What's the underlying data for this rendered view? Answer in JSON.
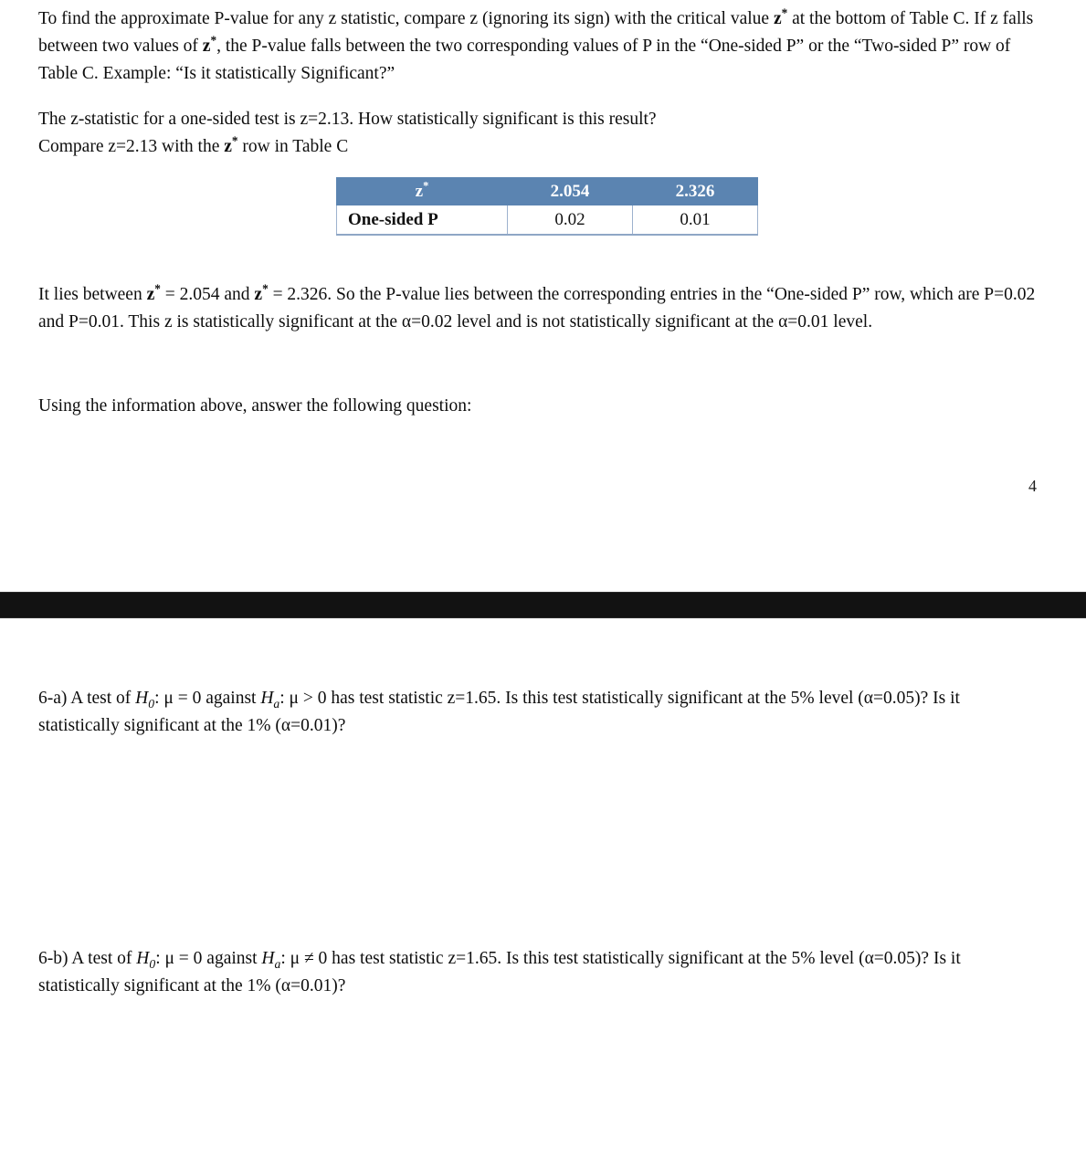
{
  "document": {
    "page_number": "4"
  },
  "intro_paragraph": {
    "seg1": "To find the approximate P-value for any z statistic, compare z (ignoring its sign) with the critical value ",
    "zstar1": "z",
    "star1": "*",
    "seg2": " at the bottom of Table C. If z falls between two values of ",
    "zstar2": "z",
    "star2": "*",
    "seg3": ", the P-value falls between the two corresponding values of P in the “One-sided P” or the “Two-sided P” row of Table C. Example: “Is it statistically Significant?”"
  },
  "example_paragraph": {
    "line1": "The z-statistic for a one-sided test is z=2.13. How statistically significant is this result?",
    "line2_seg1": "Compare z=2.13 with the ",
    "line2_zstar": "z",
    "line2_star": "*",
    "line2_seg2": " row in Table C"
  },
  "table": {
    "headers": [
      "z",
      "2.054",
      "2.326"
    ],
    "header_star": "*",
    "row_label": "One-sided P",
    "row_values": [
      "0.02",
      "0.01"
    ],
    "header_bg": "#5b84b1",
    "header_color": "#ffffff",
    "border_color": "#9db2ce"
  },
  "explanation_paragraph": {
    "seg1": "It lies between ",
    "zstar1": "z",
    "star1": "*",
    "seg2": " = 2.054 and ",
    "zstar2": "z",
    "star2": "*",
    "seg3": " = 2.326. So the P-value lies between the corresponding entries in the “One-sided P” row, which are P=0.02 and P=0.01. This z is statistically significant at the α=0.02 level and is not statistically significant at the α=0.01 level."
  },
  "prompt_line": {
    "text": "Using the information above, answer the following question:"
  },
  "questions": [
    {
      "id": "6-a",
      "label": "6-a)",
      "seg1": " A test of ",
      "h0": "H",
      "h0_sub": "0",
      "seg2": ": μ = 0 against ",
      "ha": "H",
      "ha_sub": "a",
      "seg3": ": μ > 0 has test statistic z=1.65. Is this test statistically significant at the 5% level (α=0.05)? Is it statistically significant at the 1% (α=0.01)?"
    },
    {
      "id": "6-b",
      "label": "6-b)",
      "seg1": " A test of ",
      "h0": "H",
      "h0_sub": "0",
      "seg2": ": μ = 0 against ",
      "ha": "H",
      "ha_sub": "a",
      "seg3": ": μ ≠ 0 has test statistic z=1.65. Is this test statistically significant at the 5% level (α=0.05)? Is it statistically significant at the 1% (α=0.01)?"
    }
  ],
  "separator": {
    "color": "#121212"
  }
}
